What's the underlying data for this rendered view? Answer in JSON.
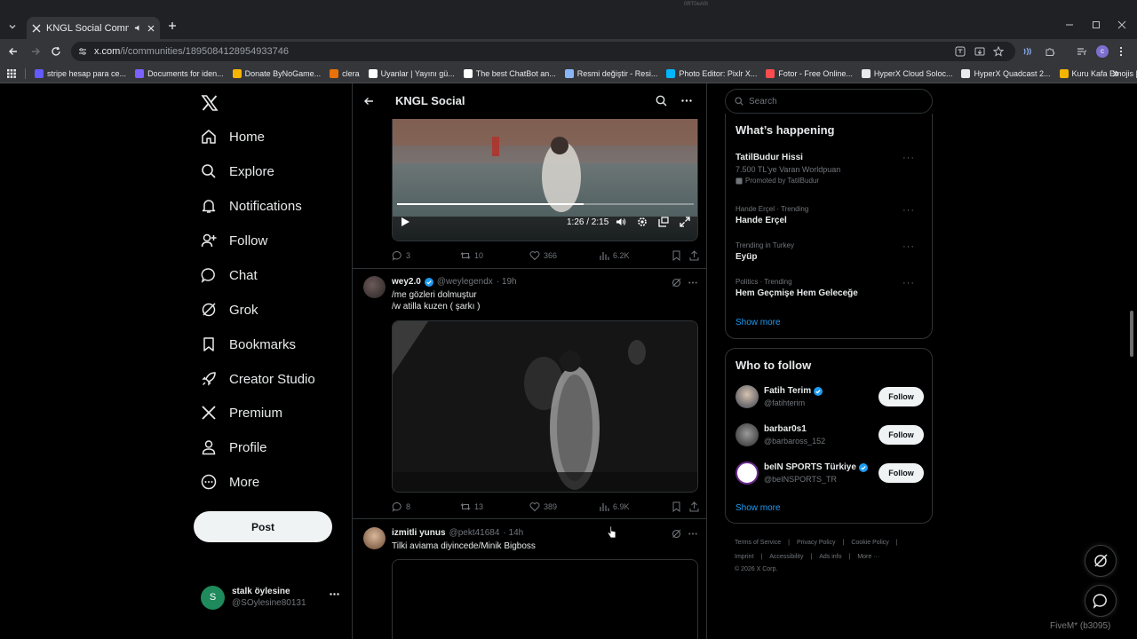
{
  "browser": {
    "tab_title": "KNGL Social Community / X",
    "url_host": "x.com",
    "url_path": "/i/communities/1895084128954933746",
    "top_center": "0RT0eA0t",
    "bookmarks": [
      {
        "label": "stripe hesap para ce...",
        "color": "#635bff"
      },
      {
        "label": "Documents for iden...",
        "color": "#7b61ff"
      },
      {
        "label": "Donate ByNoGame...",
        "color": "#f4b400"
      },
      {
        "label": "clera",
        "color": "#e8710a"
      },
      {
        "label": "Uyanlar | Yayını gü...",
        "color": "#ffffff"
      },
      {
        "label": "The best ChatBot an...",
        "color": "#ffffff"
      },
      {
        "label": "Resmi değiştir - Resi...",
        "color": "#8ab4f8"
      },
      {
        "label": "Photo Editor: Pixlr X...",
        "color": "#00b7ff"
      },
      {
        "label": "Fotor - Free Online...",
        "color": "#ff4d4f"
      },
      {
        "label": "HyperX Cloud Soloc...",
        "color": "#e8eaed"
      },
      {
        "label": "HyperX Quadcast 2...",
        "color": "#e8eaed"
      },
      {
        "label": "Kuru Kafa Emojis |...",
        "color": "#f4b400"
      }
    ]
  },
  "nav": {
    "items": [
      "Home",
      "Explore",
      "Notifications",
      "Follow",
      "Chat",
      "Grok",
      "Bookmarks",
      "Creator Studio",
      "Premium",
      "Profile",
      "More"
    ],
    "post_label": "Post",
    "account_name": "stalk öylesine",
    "account_handle": "@SOylesine80131",
    "account_initial": "S"
  },
  "header": {
    "title": "KNGL Social"
  },
  "tweets": [
    {
      "video_time": "1:26 / 2:15",
      "video_progress": 0.63,
      "replies": "3",
      "reposts": "10",
      "likes": "366",
      "views": "6.2K"
    },
    {
      "name": "wey2.0",
      "handle": "@weylegendx",
      "time": "· 19h",
      "line1": "/me gözleri dolmuştur",
      "line2": "/w atilla kuzen ( şarkı )",
      "replies": "8",
      "reposts": "13",
      "likes": "389",
      "views": "6.9K"
    },
    {
      "name": "izmitli yunus",
      "handle": "@pekt41684",
      "time": "· 14h",
      "line1": "Tilki aviama diyincede/Minik Bigboss"
    }
  ],
  "right": {
    "search_placeholder": "Search",
    "happening_title": "What’s happening",
    "trends": [
      {
        "ctx": "",
        "title": "TatilBudur Hissi",
        "sub": "7.500 TL'ye Varan Worldpuan",
        "promo": "Promoted by TatilBudur"
      },
      {
        "ctx": "Hande Erçel · Trending",
        "title": "Hande Erçel"
      },
      {
        "ctx": "Trending in Turkey",
        "title": "Eyüp"
      },
      {
        "ctx": "Politics · Trending",
        "title": "Hem Geçmişe Hem Geleceğe"
      }
    ],
    "show_more": "Show more",
    "who_title": "Who to follow",
    "follow_label": "Follow",
    "who": [
      {
        "name": "Fatih Terim",
        "handle": "@fatihterim"
      },
      {
        "name": "barbar0s1",
        "handle": "@barbaross_152"
      },
      {
        "name": "beIN SPORTS Türkiye",
        "handle": "@beINSPORTS_TR"
      }
    ],
    "footer_line1": [
      "Terms of Service",
      "|",
      "Privacy Policy",
      "|",
      "Cookie Policy",
      "|"
    ],
    "footer_line2": [
      "Imprint",
      "|",
      "Accessibility",
      "|",
      "Ads info",
      "|",
      "More ···"
    ],
    "footer_line3": "© 2026 X Corp."
  },
  "overlay": {
    "bottom_right": "FiveM* (b3095)"
  }
}
